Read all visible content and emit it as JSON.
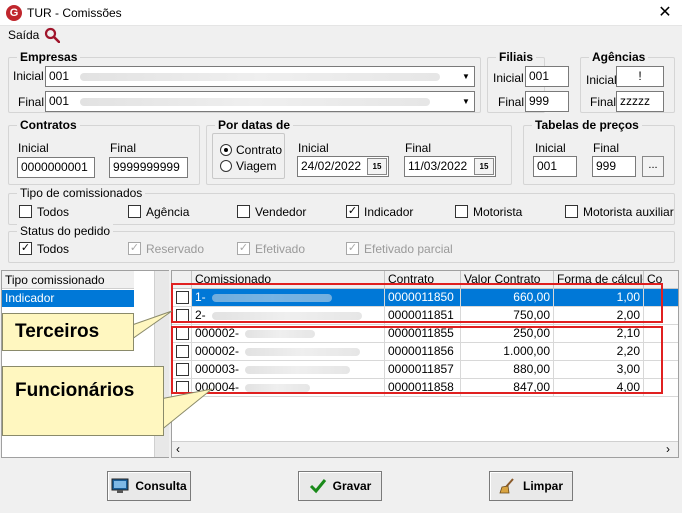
{
  "window": {
    "title": "TUR - Comissões",
    "close": "✕"
  },
  "menu": {
    "saida": "Saída"
  },
  "empresas": {
    "legend": "Empresas",
    "inicial_label": "Inicial",
    "inicial_value": "001",
    "final_label": "Final",
    "final_value": "001"
  },
  "filiais": {
    "legend": "Filiais",
    "inicial_label": "Inicial",
    "inicial_value": "001",
    "final_label": "Final",
    "final_value": "999"
  },
  "agencias": {
    "legend": "Agências",
    "inicial_label": "Inicial",
    "inicial_value": "!",
    "final_label": "Final",
    "final_value": "zzzzz"
  },
  "contratos": {
    "legend": "Contratos",
    "inicial_label": "Inicial",
    "inicial_value": "0000000001",
    "final_label": "Final",
    "final_value": "9999999999"
  },
  "por_datas": {
    "legend": "Por datas de",
    "radio_contrato": "Contrato",
    "radio_viagem": "Viagem",
    "inicial_label": "Inicial",
    "inicial_value": "24/02/2022",
    "final_label": "Final",
    "final_value": "11/03/2022",
    "cal_icon": "15"
  },
  "tabelas": {
    "legend": "Tabelas de preços",
    "inicial_label": "Inicial",
    "inicial_value": "001",
    "final_label": "Final",
    "final_value": "999",
    "more_button": "..."
  },
  "tipo_comissionados": {
    "legend": "Tipo de comissionados",
    "items": [
      {
        "label": "Todos",
        "checked": false
      },
      {
        "label": "Agência",
        "checked": false
      },
      {
        "label": "Vendedor",
        "checked": false
      },
      {
        "label": "Indicador",
        "checked": true
      },
      {
        "label": "Motorista",
        "checked": false
      },
      {
        "label": "Motorista auxiliar",
        "checked": false
      }
    ]
  },
  "status_pedido": {
    "legend": "Status do pedido",
    "items": [
      {
        "label": "Todos",
        "checked": true,
        "disabled": false
      },
      {
        "label": "Reservado",
        "checked": true,
        "disabled": true
      },
      {
        "label": "Efetivado",
        "checked": true,
        "disabled": true
      },
      {
        "label": "Efetivado parcial",
        "checked": true,
        "disabled": true
      }
    ]
  },
  "left_list": {
    "header": "Tipo comissionado",
    "selected": "Indicador"
  },
  "grid": {
    "columns": [
      "Comissionado",
      "Contrato",
      "Valor Contrato",
      "Forma de cálculo",
      "Co"
    ],
    "rows": [
      {
        "comissionado": "1-",
        "contrato": "0000011850",
        "valor": "660,00",
        "forma": "1,00"
      },
      {
        "comissionado": "2-",
        "contrato": "0000011851",
        "valor": "750,00",
        "forma": "2,00"
      },
      {
        "comissionado": "000002-",
        "contrato": "0000011855",
        "valor": "250,00",
        "forma": "2,10"
      },
      {
        "comissionado": "000002-",
        "contrato": "0000011856",
        "valor": "1.000,00",
        "forma": "2,20"
      },
      {
        "comissionado": "000003-",
        "contrato": "0000011857",
        "valor": "880,00",
        "forma": "3,00"
      },
      {
        "comissionado": "000004-",
        "contrato": "0000011858",
        "valor": "847,00",
        "forma": "4,00"
      }
    ]
  },
  "callouts": {
    "terceiros": "Terceiros",
    "funcionarios": "Funcionários"
  },
  "buttons": {
    "consulta": "Consulta",
    "gravar": "Gravar",
    "limpar": "Limpar"
  },
  "scroll": {
    "left": "‹",
    "right": "›"
  }
}
